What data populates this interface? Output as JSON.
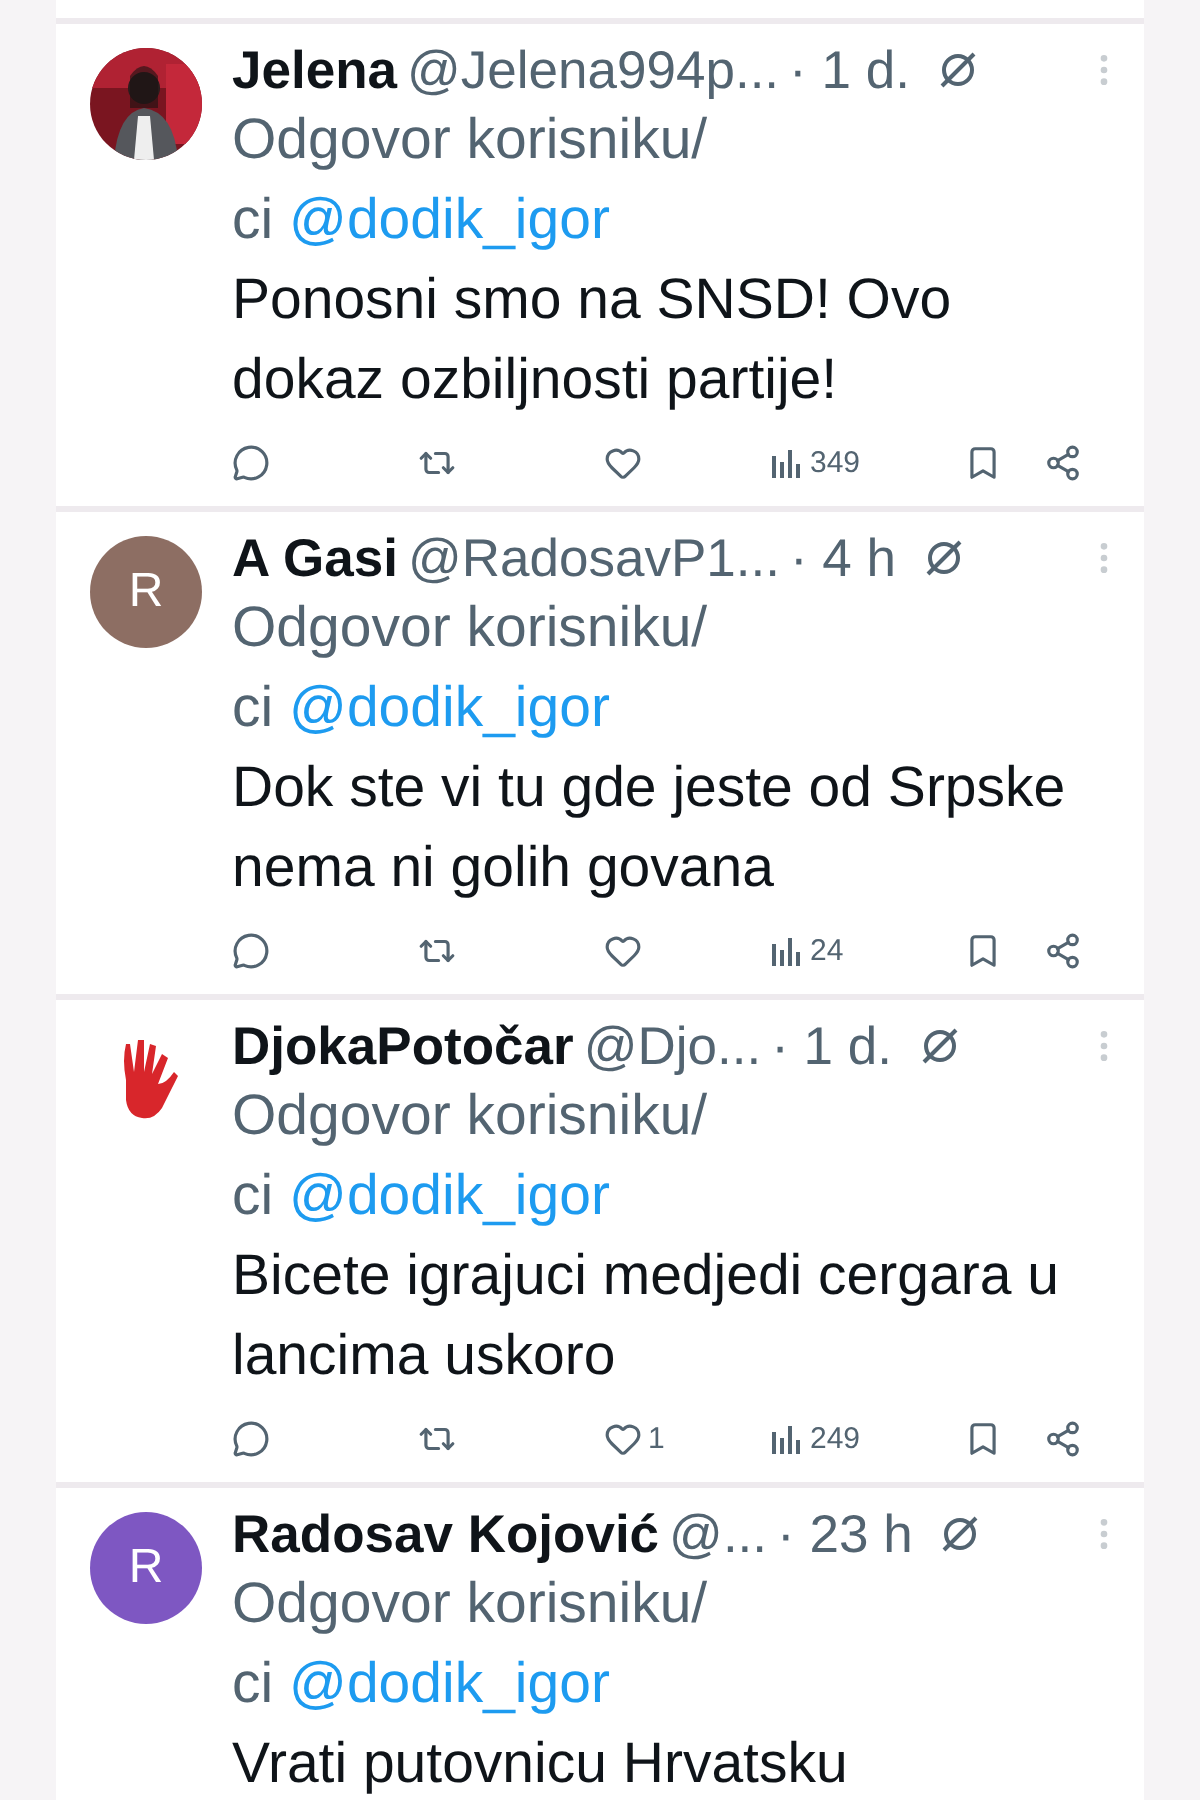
{
  "tweets": [
    {
      "name": "Jelena",
      "handle": "@Jelena994p...",
      "time": "· 1 d.",
      "reply_line": "Odgovor korisniku/",
      "reply_tail": "ci",
      "mention": "@dodik_igor",
      "body": "Ponosni smo na SNSD! Ovo dokaz ozbiljnosti partije!",
      "actions": {
        "views": "349"
      }
    },
    {
      "avatar": {
        "kind": "letter",
        "letter": "R",
        "color": "#8d6e63"
      },
      "name": "A Gasi",
      "handle": "@RadosavP1...",
      "time": "· 4 h",
      "reply_line": "Odgovor korisniku/",
      "reply_tail": "ci",
      "mention": "@dodik_igor",
      "body": "Dok ste vi tu gde jeste od Srpske nema ni golih govana",
      "actions": {
        "views": "24"
      }
    },
    {
      "avatar": {
        "kind": "hand"
      },
      "name": "DjokaPotočar",
      "handle": "@Djo...",
      "time": "· 1 d.",
      "reply_line": "Odgovor korisniku/",
      "reply_tail": "ci",
      "mention": "@dodik_igor",
      "body": "Bicete igrajuci medjedi cergara u lancima uskoro",
      "actions": {
        "likes": "1",
        "views": "249"
      }
    },
    {
      "avatar": {
        "kind": "letter",
        "letter": "R",
        "color": "#7e57c2"
      },
      "name": "Radosav Kojović",
      "handle": "@...",
      "time": "· 23 h",
      "reply_line": "Odgovor korisniku/",
      "reply_tail": "ci",
      "mention": "@dodik_igor",
      "body": "Vrati putovnicu Hrvatsku"
    }
  ]
}
